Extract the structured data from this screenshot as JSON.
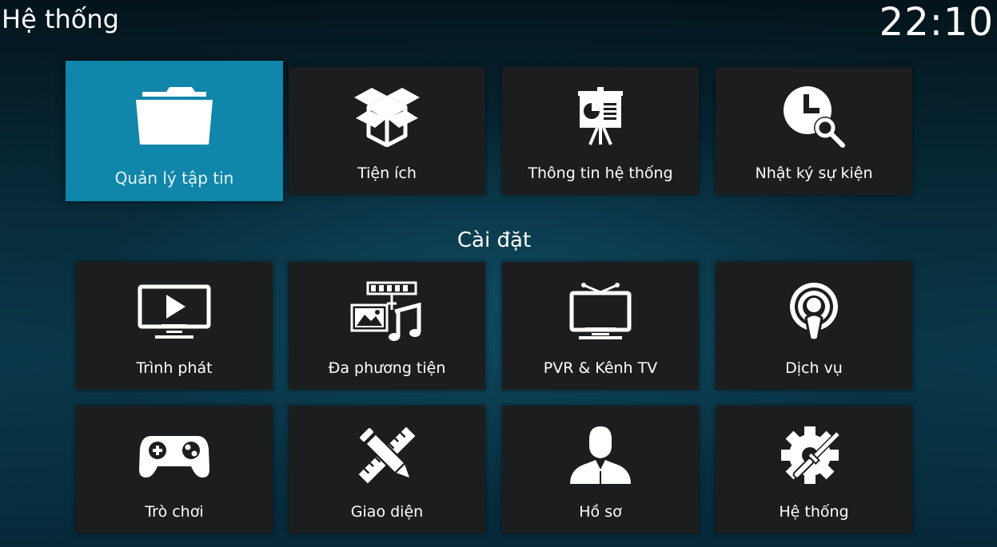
{
  "header": {
    "title": "Hệ thống",
    "clock": "22:10"
  },
  "top_row": [
    {
      "label": "Quản lý tập tin",
      "icon": "folder-icon",
      "focused": true
    },
    {
      "label": "Tiện ích",
      "icon": "box-icon"
    },
    {
      "label": "Thông tin hệ thống",
      "icon": "presentation-board-icon"
    },
    {
      "label": "Nhật ký sự kiện",
      "icon": "clock-search-icon"
    }
  ],
  "settings": {
    "title": "Cài đặt",
    "tiles": [
      {
        "label": "Trình phát",
        "icon": "monitor-play-icon"
      },
      {
        "label": "Đa phương tiện",
        "icon": "media-library-icon"
      },
      {
        "label": "PVR & Kênh TV",
        "icon": "tv-antenna-icon"
      },
      {
        "label": "Dịch vụ",
        "icon": "broadcast-icon"
      },
      {
        "label": "Trò chơi",
        "icon": "gamepad-icon"
      },
      {
        "label": "Giao diện",
        "icon": "pencil-ruler-icon"
      },
      {
        "label": "Hồ sơ",
        "icon": "user-profile-icon"
      },
      {
        "label": "Hệ thống",
        "icon": "gear-tools-icon"
      }
    ]
  },
  "colors": {
    "focus_accent": "#0f86aa",
    "tile_background": "#1c1d1f",
    "text": "#ffffff"
  }
}
